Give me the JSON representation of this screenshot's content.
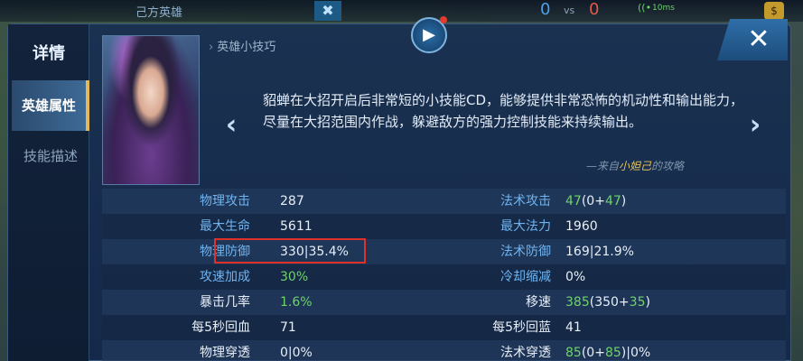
{
  "hud": {
    "team_label": "己方英雄",
    "close_glyph": "✖",
    "score_ally": "0",
    "vs": "vs",
    "score_enemy": "0",
    "ping": "10ms",
    "wifi_glyph": "((•",
    "coin_glyph": "$"
  },
  "sidebar": {
    "title": "详情",
    "tabs": [
      {
        "label": "英雄属性",
        "active": true
      },
      {
        "label": "技能描述",
        "active": false
      }
    ]
  },
  "tips": {
    "header": "英雄小技巧",
    "header_chevron": "›",
    "video_glyph": "▶",
    "close_glyph": "✕",
    "prev_glyph": "‹",
    "next_glyph": "›",
    "text": "貂蝉在大招开启后非常短的小技能CD，能够提供非常恐怖的机动性和输出能力，尽量在大招范围内作战，躲避敌方的强力控制技能来持续输出。",
    "source_prefix": "—来自",
    "source_hero": "小妲己",
    "source_suffix": "的攻略"
  },
  "stats": [
    {
      "l_label": "物理攻击",
      "l_label_color": "blue",
      "l_value": "287",
      "l_green": "",
      "r_label": "法术攻击",
      "r_label_color": "blue",
      "r_value_green": "47",
      "r_value": "(0+",
      "r_value_green2": "47",
      "r_value_end": ")"
    },
    {
      "l_label": "最大生命",
      "l_label_color": "blue",
      "l_value": "5611",
      "l_green": "",
      "r_label": "最大法力",
      "r_label_color": "blue",
      "r_value_green": "",
      "r_value": "1960",
      "r_value_green2": "",
      "r_value_end": ""
    },
    {
      "l_label": "物理防御",
      "l_label_color": "blue",
      "l_value": "330|35.4%",
      "l_green": "",
      "r_label": "法术防御",
      "r_label_color": "blue",
      "r_value_green": "",
      "r_value": "169|21.9%",
      "r_value_green2": "",
      "r_value_end": ""
    },
    {
      "l_label": "攻速加成",
      "l_label_color": "blue",
      "l_value": "",
      "l_green": "30%",
      "r_label": "冷却缩减",
      "r_label_color": "blue",
      "r_value_green": "",
      "r_value": "0%",
      "r_value_green2": "",
      "r_value_end": ""
    },
    {
      "l_label": "暴击几率",
      "l_label_color": "white",
      "l_value": "",
      "l_green": "1.6%",
      "r_label": "移速",
      "r_label_color": "white",
      "r_value_green": "385",
      "r_value": "(350+",
      "r_value_green2": "35",
      "r_value_end": ")"
    },
    {
      "l_label": "每5秒回血",
      "l_label_color": "white",
      "l_value": "71",
      "l_green": "",
      "r_label": "每5秒回蓝",
      "r_label_color": "white",
      "r_value_green": "",
      "r_value": "41",
      "r_value_green2": "",
      "r_value_end": ""
    },
    {
      "l_label": "物理穿透",
      "l_label_color": "white",
      "l_value": "0|0%",
      "l_green": "",
      "r_label": "法术穿透",
      "r_label_color": "white",
      "r_value_green": "85",
      "r_value": "(0+",
      "r_value_green2": "85",
      "r_value_end": ")|0%"
    }
  ]
}
